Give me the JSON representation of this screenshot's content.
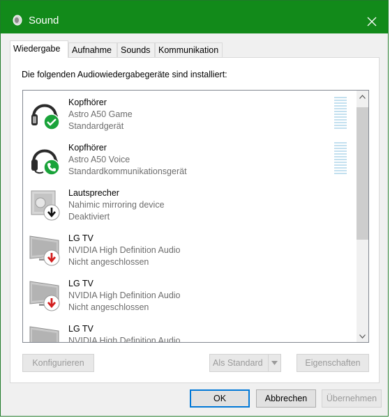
{
  "window": {
    "title": "Sound",
    "close_icon": "close-icon",
    "app_icon": "speaker-icon",
    "accent_color": "#128a1a"
  },
  "tabs": [
    {
      "label": "Wiedergabe",
      "active": true
    },
    {
      "label": "Aufnahme",
      "active": false
    },
    {
      "label": "Sounds",
      "active": false
    },
    {
      "label": "Kommunikation",
      "active": false
    }
  ],
  "panel": {
    "intro": "Die folgenden Audiowiedergabegeräte sind installiert:"
  },
  "devices": [
    {
      "name": "Kopfhörer",
      "model": "Astro A50 Game",
      "status": "Standardgerät",
      "icon": "headphones-icon",
      "badge": "default-check-badge"
    },
    {
      "name": "Kopfhörer",
      "model": "Astro A50 Voice",
      "status": "Standardkommunikationsgerät",
      "icon": "headset-icon",
      "badge": "communication-phone-badge"
    },
    {
      "name": "Lautsprecher",
      "model": "Nahimic mirroring device",
      "status": "Deaktiviert",
      "icon": "speaker-box-icon",
      "badge": "disabled-arrow-badge"
    },
    {
      "name": "LG TV",
      "model": "NVIDIA High Definition Audio",
      "status": "Nicht angeschlossen",
      "icon": "monitor-icon",
      "badge": "unplugged-arrow-badge"
    },
    {
      "name": "LG TV",
      "model": "NVIDIA High Definition Audio",
      "status": "Nicht angeschlossen",
      "icon": "monitor-icon",
      "badge": "unplugged-arrow-badge"
    },
    {
      "name": "LG TV",
      "model": "NVIDIA High Definition Audio",
      "status": "",
      "icon": "monitor-icon",
      "badge": ""
    }
  ],
  "buttons": {
    "configure": "Konfigurieren",
    "set_default": "Als Standard",
    "properties": "Eigenschaften",
    "ok": "OK",
    "cancel": "Abbrechen",
    "apply": "Übernehmen"
  }
}
